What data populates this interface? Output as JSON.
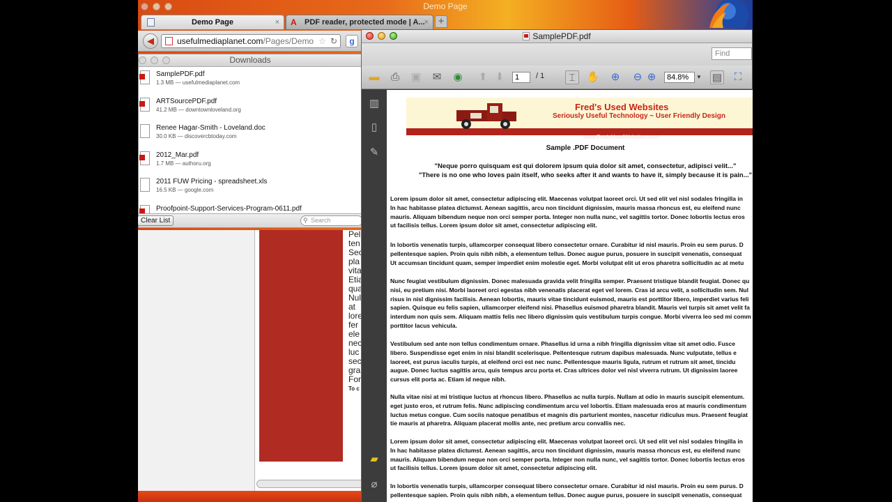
{
  "os_title": "Demo Page",
  "tabs": [
    {
      "label": "Demo Page",
      "close": "×"
    },
    {
      "label": "PDF reader, protected mode | A...",
      "close": "×"
    }
  ],
  "new_tab": "+",
  "url": {
    "host": "usefulmediaplanet.com",
    "path": "/Pages/Demo"
  },
  "downloads": {
    "title": "Downloads",
    "items": [
      {
        "name": "SamplePDF.pdf",
        "meta": "1.3 MB — usefulmediaplanet.com",
        "type": "pdf"
      },
      {
        "name": "ARTSourcePDF.pdf",
        "meta": "41.2 MB — downtownloveland.org",
        "type": "pdf"
      },
      {
        "name": "Renee Hagar-Smith - Loveland.doc",
        "meta": "30.0 KB — discovercbtoday.com",
        "type": "doc"
      },
      {
        "name": "2012_Mar.pdf",
        "meta": "1.7 MB — authoru.org",
        "type": "pdf"
      },
      {
        "name": "2011 FUW Pricing - spreadsheet.xls",
        "meta": "16.5 KB — google.com",
        "type": "doc"
      },
      {
        "name": "Proofpoint-Support-Services-Program-0611.pdf",
        "meta": "",
        "type": "pdf"
      }
    ],
    "clear_label": "Clear List",
    "search_placeholder": "Search"
  },
  "page_behind": {
    "text_lines": [
      "Pel",
      "ten",
      "Sec",
      "pla",
      "vita",
      "Etia",
      "qua",
      "",
      "Nul",
      "at",
      "lore",
      "fer",
      "ele",
      "nec",
      "luc",
      "sec",
      "gra",
      "",
      "For",
      "",
      "To c"
    ]
  },
  "pdf_window": {
    "title": "SamplePDF.pdf",
    "find_placeholder": "Find",
    "page_current": "1",
    "page_total": "/ 1",
    "zoom": "84.8%",
    "banner": {
      "title": "Fred's Used Websites",
      "subtitle": "Seriously Useful Technology ~ User Friendly Design",
      "url": "www.FredsUsedWebsites.com"
    },
    "heading": "Sample .PDF Document",
    "quote1": "\"Neque porro quisquam est qui dolorem ipsum quia dolor sit amet, consectetur, adipisci velit...\"",
    "quote2": "\"There is no one who loves pain itself, who seeks after it and wants to have it, simply because it is pain...\"",
    "paragraphs": [
      [
        "Lorem ipsum dolor sit amet, consectetur adipiscing elit. Maecenas volutpat laoreet orci. Ut sed elit vel nisl sodales fringilla in",
        "In hac habitasse platea dictumst. Aenean sagittis, arcu non tincidunt dignissim, mauris massa rhoncus est, eu eleifend nunc",
        "mauris. Aliquam bibendum neque non orci semper porta. Integer non nulla nunc, vel sagittis tortor. Donec lobortis lectus eros",
        "ut facilisis tellus. Lorem ipsum dolor sit amet, consectetur adipiscing elit."
      ],
      [
        "In lobortis venenatis turpis, ullamcorper consequat libero consectetur ornare. Curabitur id nisl mauris. Proin eu sem purus. D",
        "pellentesque sapien. Proin quis nibh nibh, a elementum tellus. Donec augue purus, posuere in suscipit venenatis, consequat",
        "Ut accumsan tincidunt quam, semper imperdiet enim molestie eget. Morbi volutpat elit ut eros pharetra sollicitudin ac at metu"
      ],
      [
        "Nunc feugiat vestibulum dignissim. Donec malesuada gravida velit fringilla semper. Praesent tristique blandit feugiat. Donec qu",
        "nisi, eu pretium nisi. Morbi laoreet orci egestas nibh venenatis placerat eget vel lorem. Cras id arcu velit, a sollicitudin sem. Nul",
        "risus in nisl dignissim facilisis. Aenean lobortis, mauris vitae tincidunt euismod, mauris est porttitor libero, imperdiet varius feli",
        "sapien. Quisque eu felis sapien, ullamcorper eleifend nisi. Phasellus euismod pharetra blandit. Mauris vel turpis sit amet velit fa",
        "interdum non quis sem. Aliquam mattis felis nec libero dignissim quis vestibulum turpis congue. Morbi viverra leo sed mi comm",
        "porttitor lacus vehicula."
      ],
      [
        "Vestibulum sed ante non tellus condimentum ornare. Phasellus id urna a nibh fringilla dignissim vitae sit amet odio. Fusce",
        "libero. Suspendisse eget enim in nisi blandit scelerisque. Pellentesque rutrum dapibus malesuada. Nunc vulputate, tellus e",
        "laoreet, est purus iaculis turpis, at eleifend orci est nec nunc. Pellentesque mauris ligula, rutrum et rutrum sit amet, tincidu",
        "augue. Donec luctus sagittis arcu, quis tempus arcu porta et. Cras ultrices dolor vel nisl viverra rutrum. Ut dignissim laoree",
        "cursus elit porta ac. Etiam id neque nibh."
      ],
      [
        "Nulla vitae nisi at mi tristique luctus at rhoncus libero. Phasellus ac nulla turpis. Nullam at odio in mauris suscipit elementum.",
        "eget justo eros, et rutrum felis. Nunc adipiscing condimentum arcu vel lobortis. Etiam malesuada eros at mauris condimentum",
        "luctus metus congue. Cum sociis natoque penatibus et magnis dis parturient montes, nascetur ridiculus mus. Praesent feugiat",
        "tie mauris at pharetra. Aliquam placerat mollis ante, nec pretium arcu convallis nec."
      ],
      [
        "Lorem ipsum dolor sit amet, consectetur adipiscing elit. Maecenas volutpat laoreet orci. Ut sed elit vel nisl sodales fringilla in",
        "In hac habitasse platea dictumst. Aenean sagittis, arcu non tincidunt dignissim, mauris massa rhoncus est, eu eleifend nunc",
        "mauris. Aliquam bibendum neque non orci semper porta. Integer non nulla nunc, vel sagittis tortor. Donec lobortis lectus eros",
        "ut facilisis tellus. Lorem ipsum dolor sit amet, consectetur adipiscing elit."
      ],
      [
        "In lobortis venenatis turpis, ullamcorper consequat libero consectetur ornare. Curabitur id nisl mauris. Proin eu sem purus. D",
        "pellentesque sapien. Proin quis nibh nibh, a elementum tellus. Donec augue purus, posuere in suscipit venenatis, consequat"
      ]
    ]
  }
}
